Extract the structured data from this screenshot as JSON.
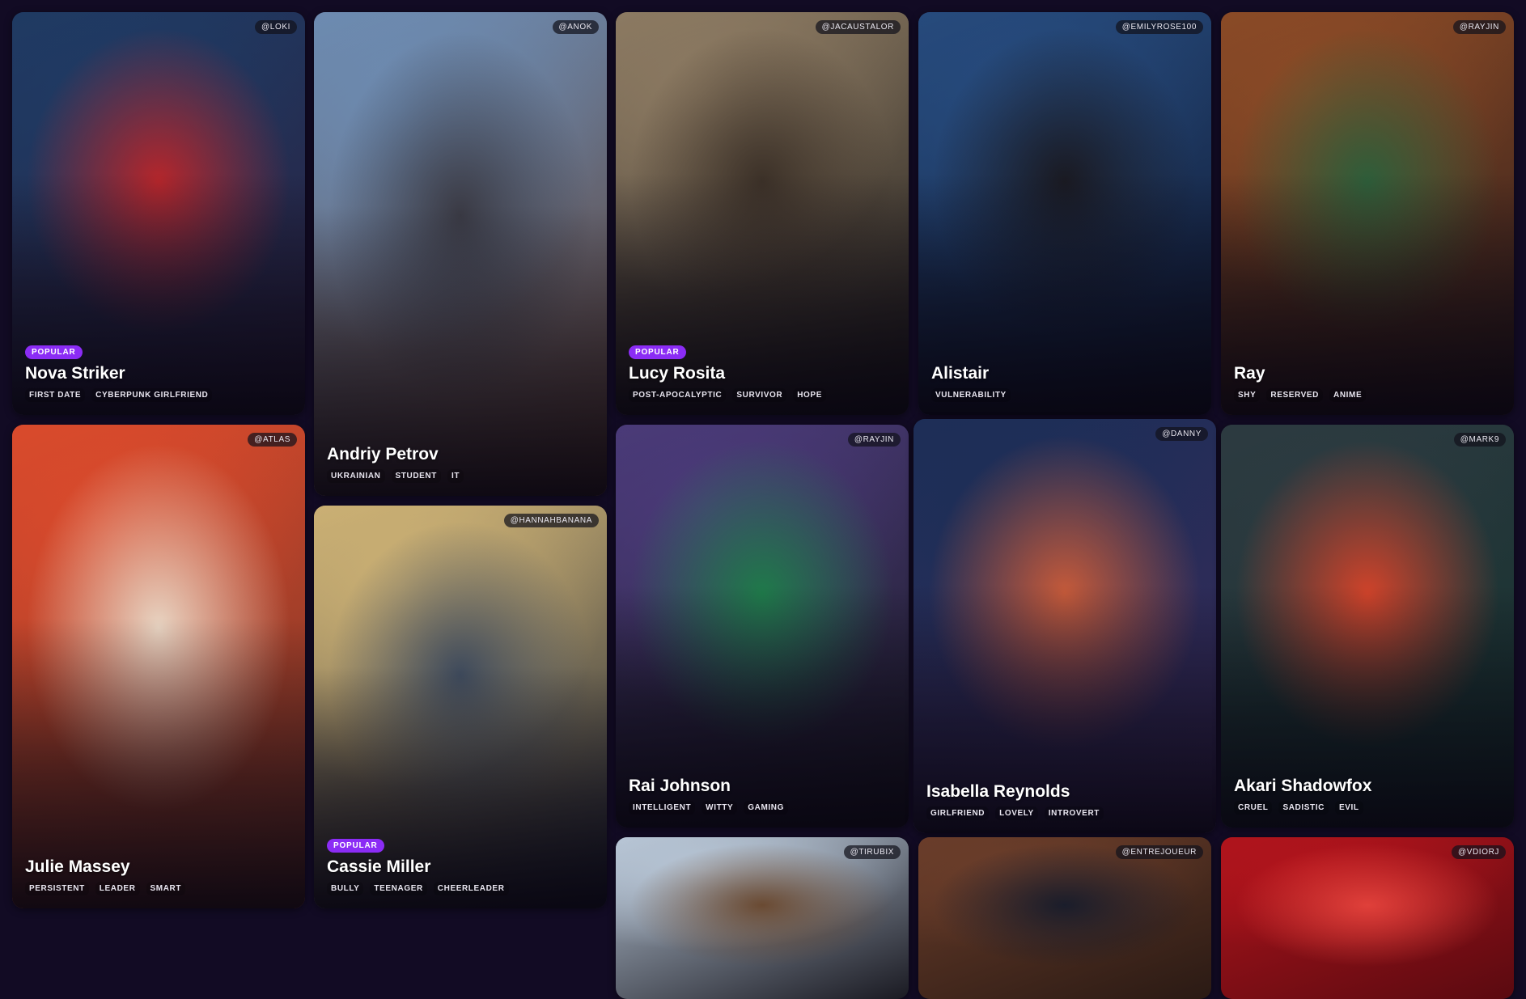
{
  "cards": [
    {
      "author": "@LOKI",
      "popular": true,
      "badge": "POPULAR",
      "name": "Nova Striker",
      "tags": [
        "FIRST DATE",
        "CYBERPUNK GIRLFRIEND"
      ],
      "palette": [
        "#1f3a63",
        "#b5262b",
        "#2b1f3d"
      ]
    },
    {
      "author": "@ANOK",
      "popular": false,
      "badge": "",
      "name": "Andriy Petrov",
      "tags": [
        "UKRAINIAN",
        "STUDENT",
        "IT"
      ],
      "palette": [
        "#6d8bb1",
        "#3a3a44",
        "#5c3c2e"
      ]
    },
    {
      "author": "@JACAUSTALOR",
      "popular": true,
      "badge": "POPULAR",
      "name": "Lucy Rosita",
      "tags": [
        "POST-APOCALYPTIC",
        "SURVIVOR",
        "HOPE"
      ],
      "palette": [
        "#8c7a62",
        "#3c3128",
        "#1c1a19"
      ]
    },
    {
      "author": "@EMILYROSE100",
      "popular": false,
      "badge": "",
      "name": "Alistair",
      "tags": [
        "VULNERABILITY"
      ],
      "palette": [
        "#264a7c",
        "#1a1a22",
        "#0f1830"
      ]
    },
    {
      "author": "@RAYJIN",
      "popular": false,
      "badge": "",
      "name": "Ray",
      "tags": [
        "SHY",
        "RESERVED",
        "ANIME"
      ],
      "palette": [
        "#8a4a26",
        "#2e5e3a",
        "#2b1b1a"
      ]
    },
    {
      "author": "@ATLAS",
      "popular": false,
      "badge": "",
      "name": "Julie Massey",
      "tags": [
        "PERSISTENT",
        "LEADER",
        "SMART"
      ],
      "palette": [
        "#d94a2c",
        "#e8d4c2",
        "#6e3326"
      ]
    },
    {
      "author": "@HANNAHBANANA",
      "popular": true,
      "badge": "POPULAR",
      "name": "Cassie Miller",
      "tags": [
        "BULLY",
        "TEENAGER",
        "CHEERLEADER"
      ],
      "palette": [
        "#cbb074",
        "#3e4a5c",
        "#1c2333"
      ]
    },
    {
      "author": "@RAYJIN",
      "popular": false,
      "badge": "",
      "name": "Rai Johnson",
      "tags": [
        "INTELLIGENT",
        "WITTY",
        "GAMING"
      ],
      "palette": [
        "#4a3a78",
        "#1f7a4a",
        "#1a1a24"
      ]
    },
    {
      "author": "@DANNY",
      "popular": false,
      "badge": "",
      "name": "Isabella Reynolds",
      "tags": [
        "GIRLFRIEND",
        "LOVELY",
        "INTROVERT"
      ],
      "palette": [
        "#1d2e57",
        "#c55a3a",
        "#3b2a5a"
      ]
    },
    {
      "author": "@MARK9",
      "popular": false,
      "badge": "",
      "name": "Akari Shadowfox",
      "tags": [
        "CRUEL",
        "SADISTIC",
        "EVIL"
      ],
      "palette": [
        "#2c3a40",
        "#d0432a",
        "#13302c"
      ]
    },
    {
      "author": "@TIRUBIX",
      "popular": false,
      "badge": "",
      "name": "",
      "tags": [],
      "palette": [
        "#b8c6d6",
        "#6a4a32",
        "#1a1a22"
      ]
    },
    {
      "author": "@ENTREJOUEUR",
      "popular": false,
      "badge": "",
      "name": "",
      "tags": [],
      "palette": [
        "#6a3d2a",
        "#1a1d2b",
        "#2a1a14"
      ]
    },
    {
      "author": "@VDIORJ",
      "popular": false,
      "badge": "",
      "name": "",
      "tags": [],
      "palette": [
        "#b0141c",
        "#e0403a",
        "#5a0a10"
      ]
    }
  ]
}
